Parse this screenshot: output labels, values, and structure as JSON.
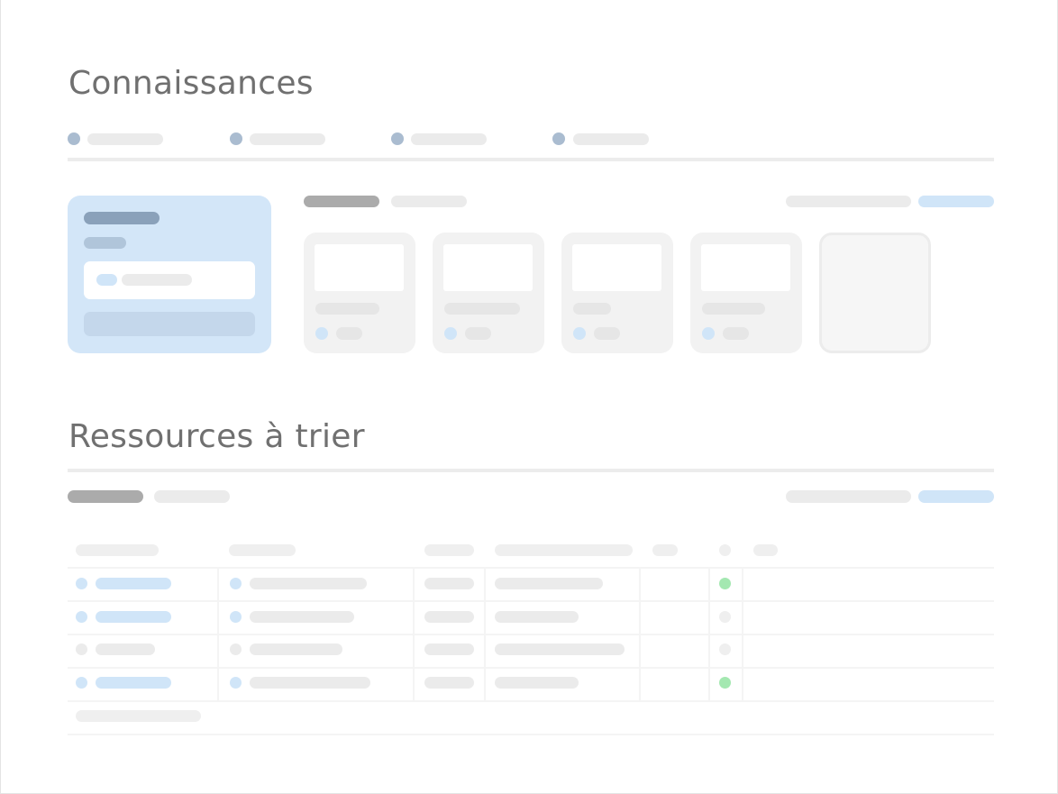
{
  "sections": {
    "knowledge_title": "Connaissances",
    "resources_title": "Ressources à trier"
  },
  "colors": {
    "accent_blue": "#d0e5f8",
    "status_green": "#a4e8b1",
    "heading_grey": "#707070"
  },
  "knowledge": {
    "tabs": [
      "tab-1",
      "tab-2",
      "tab-3",
      "tab-4"
    ],
    "cards": [
      "card-1",
      "card-2",
      "card-3",
      "card-4"
    ]
  },
  "resources": {
    "rows": [
      {
        "status": "green"
      },
      {
        "status": "grey"
      },
      {
        "status": "grey"
      },
      {
        "status": "green"
      }
    ]
  }
}
